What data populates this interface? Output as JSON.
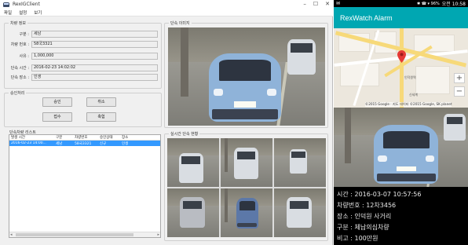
{
  "window": {
    "title": "RexIGClient",
    "controls": [
      "–",
      "☐",
      "✕"
    ]
  },
  "menu": [
    "파일",
    "설정",
    "보기"
  ],
  "vehicle_info": {
    "title": "차량 정보",
    "fields": [
      {
        "label": "구분 :",
        "value": "세남"
      },
      {
        "label": "차량 번호 :",
        "value": "58국3321"
      },
      {
        "label": "사유 :",
        "value": "1,000,000"
      },
      {
        "label": "단속 시간 :",
        "value": "2016-02-23 14:02:02"
      },
      {
        "label": "단속 장소 :",
        "value": "인생"
      }
    ]
  },
  "approval": {
    "title": "승인처리",
    "buttons": [
      "승인",
      "취소",
      "접수",
      "축험"
    ]
  },
  "violation_list": {
    "title": "단속차량 리스트",
    "columns": [
      "발생 시간",
      "구분",
      "차량번호",
      "승인상태",
      "장소"
    ],
    "rows": [
      [
        "2016-02-23 14:00...",
        "세남",
        "58국3321",
        "신규",
        "인생"
      ]
    ]
  },
  "capture_image": {
    "title": "단속 이미지"
  },
  "live_view": {
    "title": "실시간 단속 현황"
  },
  "phone": {
    "status": {
      "left_icon": "✉",
      "right_text": "✱ ☎ ▾ 96%",
      "time": "오전 10:58"
    },
    "app_title": "RexWatch Alarm",
    "map": {
      "labels": [
        "인덕원역",
        "신세계"
      ],
      "copyright": "©2015 Google · 지도 데이터 ©2015 Google, SK planet"
    },
    "zoom_in": "+",
    "zoom_out": "−",
    "details": [
      "시간 : 2016-03-07 10:57:56",
      "차량번호 : 12차3456",
      "장소 : 인덕원 사거리",
      "구분 : 체납의심차량",
      "비고 : 100만원"
    ]
  }
}
